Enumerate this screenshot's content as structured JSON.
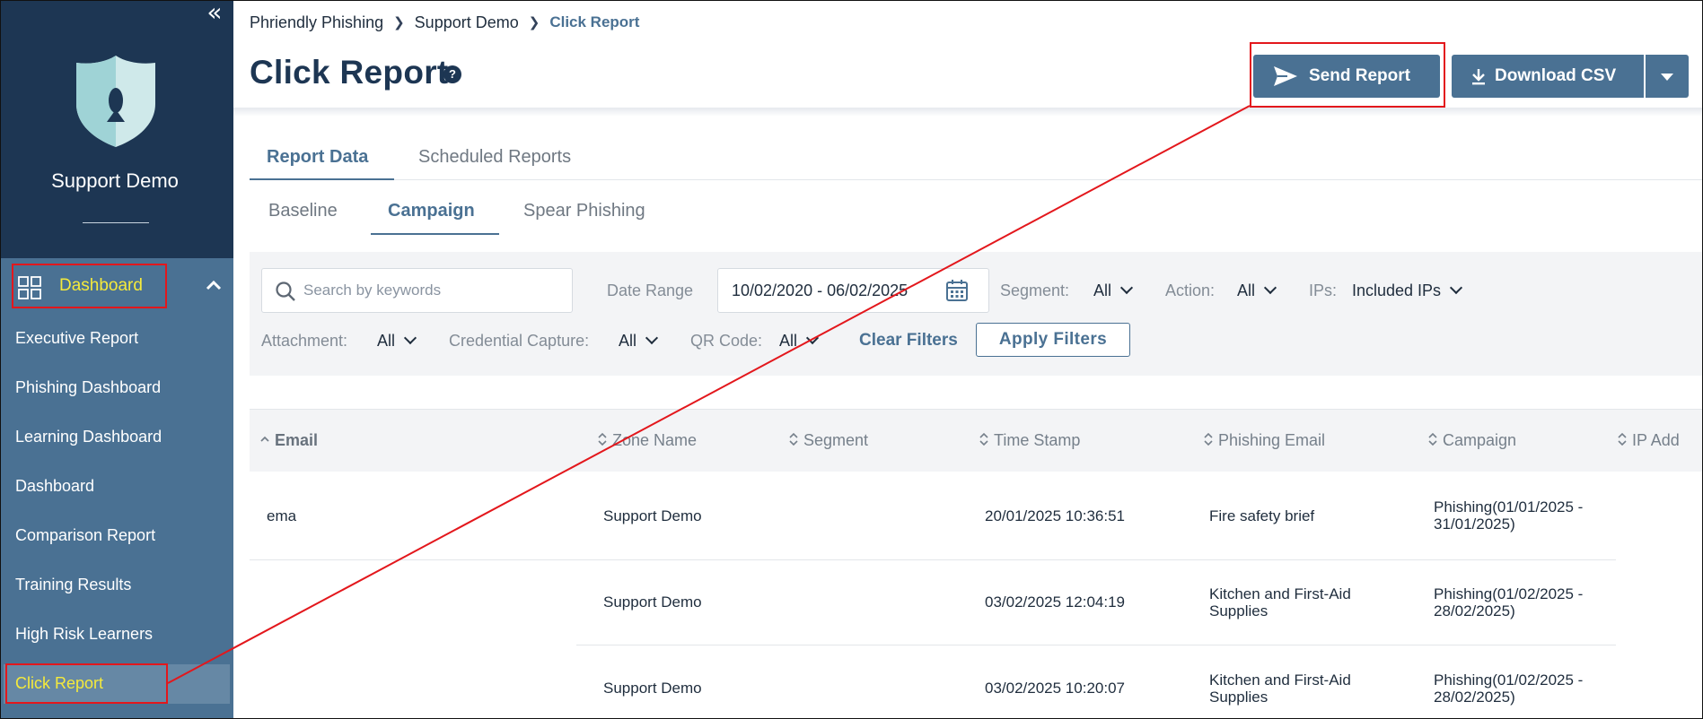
{
  "sidebar": {
    "org_name": "Support Demo",
    "collapse_glyph": "«",
    "section_label": "Dashboard",
    "items": [
      {
        "label": "Executive Report"
      },
      {
        "label": "Phishing Dashboard"
      },
      {
        "label": "Learning Dashboard"
      },
      {
        "label": "Dashboard"
      },
      {
        "label": "Comparison Report"
      },
      {
        "label": "Training Results"
      },
      {
        "label": "High Risk Learners"
      },
      {
        "label": "Click Report",
        "active": true
      }
    ]
  },
  "breadcrumb": {
    "items": [
      "Phriendly Phishing",
      "Support Demo"
    ],
    "current": "Click Report"
  },
  "header": {
    "title": "Click Report",
    "help_glyph": "?",
    "send_label": "Send Report",
    "download_label": "Download CSV"
  },
  "tabs": {
    "primary": [
      "Report Data",
      "Scheduled Reports"
    ],
    "secondary": [
      "Baseline",
      "Campaign",
      "Spear Phishing"
    ]
  },
  "filters": {
    "search_placeholder": "Search by keywords",
    "date_label": "Date Range",
    "date_value": "10/02/2020 - 06/02/2025",
    "segment_label": "Segment:",
    "segment_value": "All",
    "action_label": "Action:",
    "action_value": "All",
    "ips_label": "IPs:",
    "ips_value": "Included IPs",
    "attachment_label": "Attachment:",
    "attachment_value": "All",
    "credential_label": "Credential Capture:",
    "credential_value": "All",
    "qr_label": "QR Code:",
    "qr_value": "All",
    "clear_label": "Clear Filters",
    "apply_label": "Apply Filters"
  },
  "table": {
    "columns": [
      "Email",
      "Zone Name",
      "Segment",
      "Time Stamp",
      "Phishing Email",
      "Campaign",
      "IP Add"
    ],
    "rows": [
      {
        "email": "ema",
        "zone": "Support Demo",
        "segment": "",
        "timestamp": "20/01/2025 10:36:51",
        "phishing_email": "Fire safety brief",
        "campaign": "Phishing(01/01/2025 - 31/01/2025)"
      },
      {
        "email": "",
        "zone": "Support Demo",
        "segment": "",
        "timestamp": "03/02/2025 12:04:19",
        "phishing_email": "Kitchen and First-Aid Supplies",
        "campaign": "Phishing(01/02/2025 - 28/02/2025)"
      },
      {
        "email": "",
        "zone": "Support Demo",
        "segment": "",
        "timestamp": "03/02/2025 10:20:07",
        "phishing_email": "Kitchen and First-Aid Supplies",
        "campaign": "Phishing(01/02/2025 - 28/02/2025)"
      }
    ]
  },
  "colors": {
    "sidebar_dark": "#1d3653",
    "sidebar": "#4a7193",
    "accent": "#4a7193",
    "highlight_text": "#f5ea3b",
    "annotation_red": "#e3171c"
  }
}
